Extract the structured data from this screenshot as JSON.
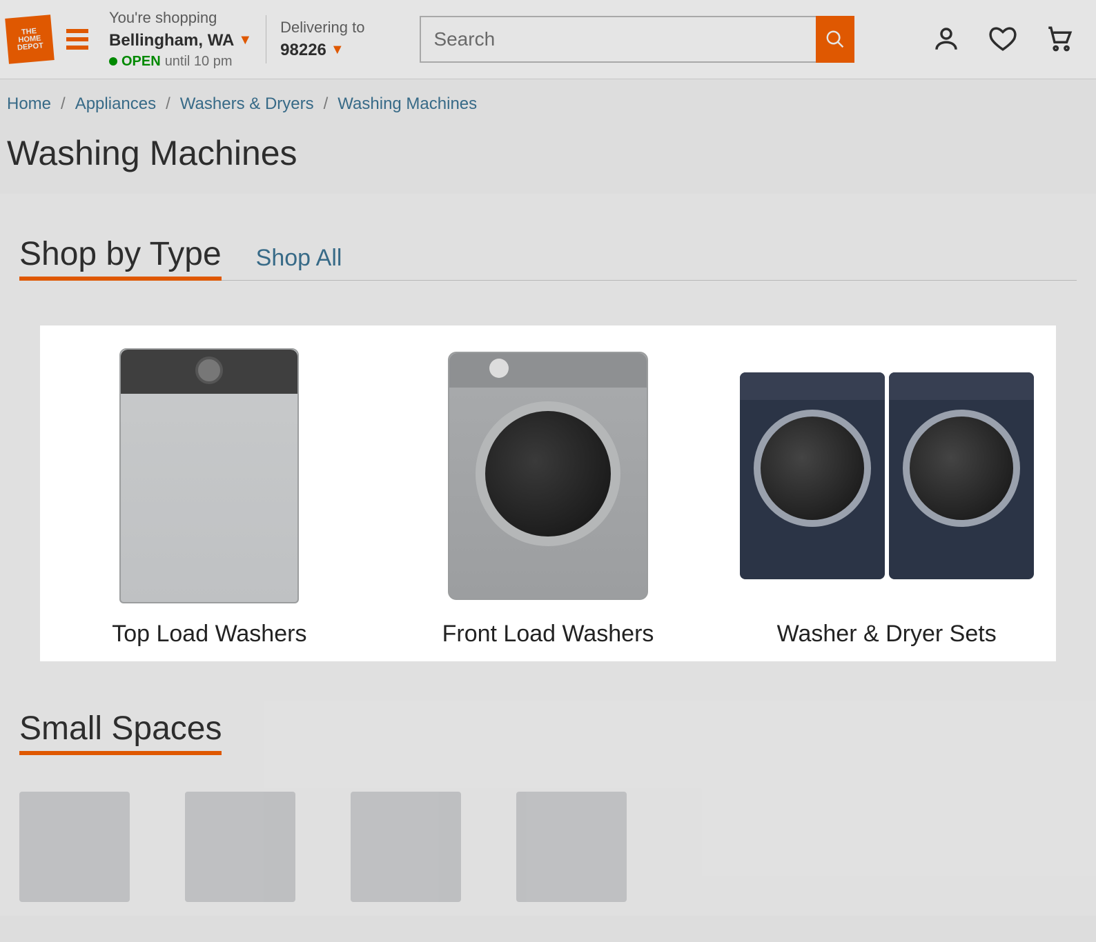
{
  "header": {
    "shopping_label": "You're shopping",
    "shopping_location": "Bellingham, WA",
    "open_label": "OPEN",
    "until_label": "until 10 pm",
    "delivering_label": "Delivering to",
    "delivering_zip": "98226",
    "search_placeholder": "Search"
  },
  "breadcrumb": {
    "b1": "Home",
    "b2": "Appliances",
    "b3": "Washers & Dryers",
    "b4": "Washing Machines"
  },
  "page_title": "Washing Machines",
  "tabs": {
    "shop_by_type": "Shop by Type",
    "shop_all": "Shop All"
  },
  "cards": {
    "top_load": "Top Load Washers",
    "front_load": "Front Load Washers",
    "sets": "Washer & Dryer Sets"
  },
  "small_spaces": "Small Spaces"
}
